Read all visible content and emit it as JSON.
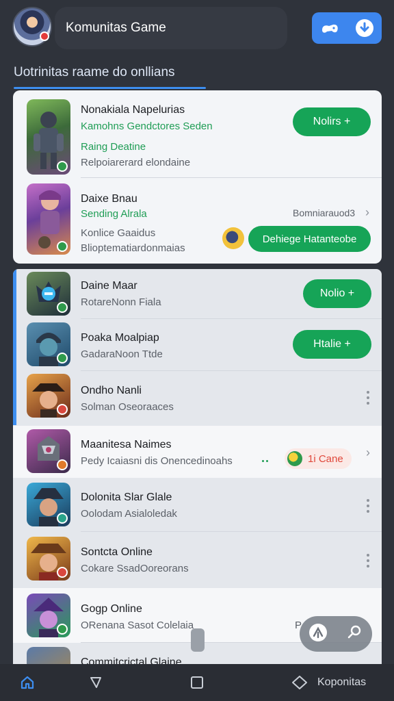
{
  "header": {
    "title": "Komunitas Game",
    "actions": [
      "controller-icon",
      "download-icon"
    ]
  },
  "section": {
    "title": "Uotrinitas raame do onllians"
  },
  "featured": [
    {
      "name": "Nonakiala Napelurias",
      "green": "Kamohns Gendctores Seden",
      "sub1": "Raing Deatine",
      "sub2": "Relpoiarerard elondaine",
      "button": "Nolirs +"
    },
    {
      "name": "Daixe Bnau",
      "green": "Sending Alrala",
      "sub1": "Konlice Gaaidus",
      "sub2": "Blioptematiardonmaias",
      "meta": "Bomniarauod3",
      "button": "Dehiege Hatanteobe"
    }
  ],
  "list": [
    {
      "name": "Daine Maar",
      "sub": "RotareΝonn Fiala",
      "button": "Nolio +"
    },
    {
      "name": "Poaka Moalpiap",
      "sub": "GadaraΝoon Ttde",
      "button": "Htalie +"
    },
    {
      "name": "Ondho Nanli",
      "sub": "Solman Oseoraaces"
    },
    {
      "name": "Maanitesa Naimes",
      "sub": "Pedy Icaiasni dis Onencedinoahs",
      "tag": "1i Cane"
    },
    {
      "name": "Dolonita Slar Glale",
      "sub": "Oolodam Asialoledak"
    },
    {
      "name": "Sontcta Online",
      "sub": "Cokare SsadOoreorans"
    },
    {
      "name": "Gogp Online",
      "sub": "ORenana Sasot Colelaia",
      "meta": "P"
    },
    {
      "name": "Commitcrictal Glaine"
    }
  ],
  "bottom_nav": {
    "items": [
      "home-icon",
      "explore-icon",
      "square-icon",
      "diamond-icon"
    ],
    "label": "Koponitas"
  },
  "colors": {
    "accent": "#3d8ef0",
    "green": "#16a457",
    "dark": "#2f333b"
  }
}
